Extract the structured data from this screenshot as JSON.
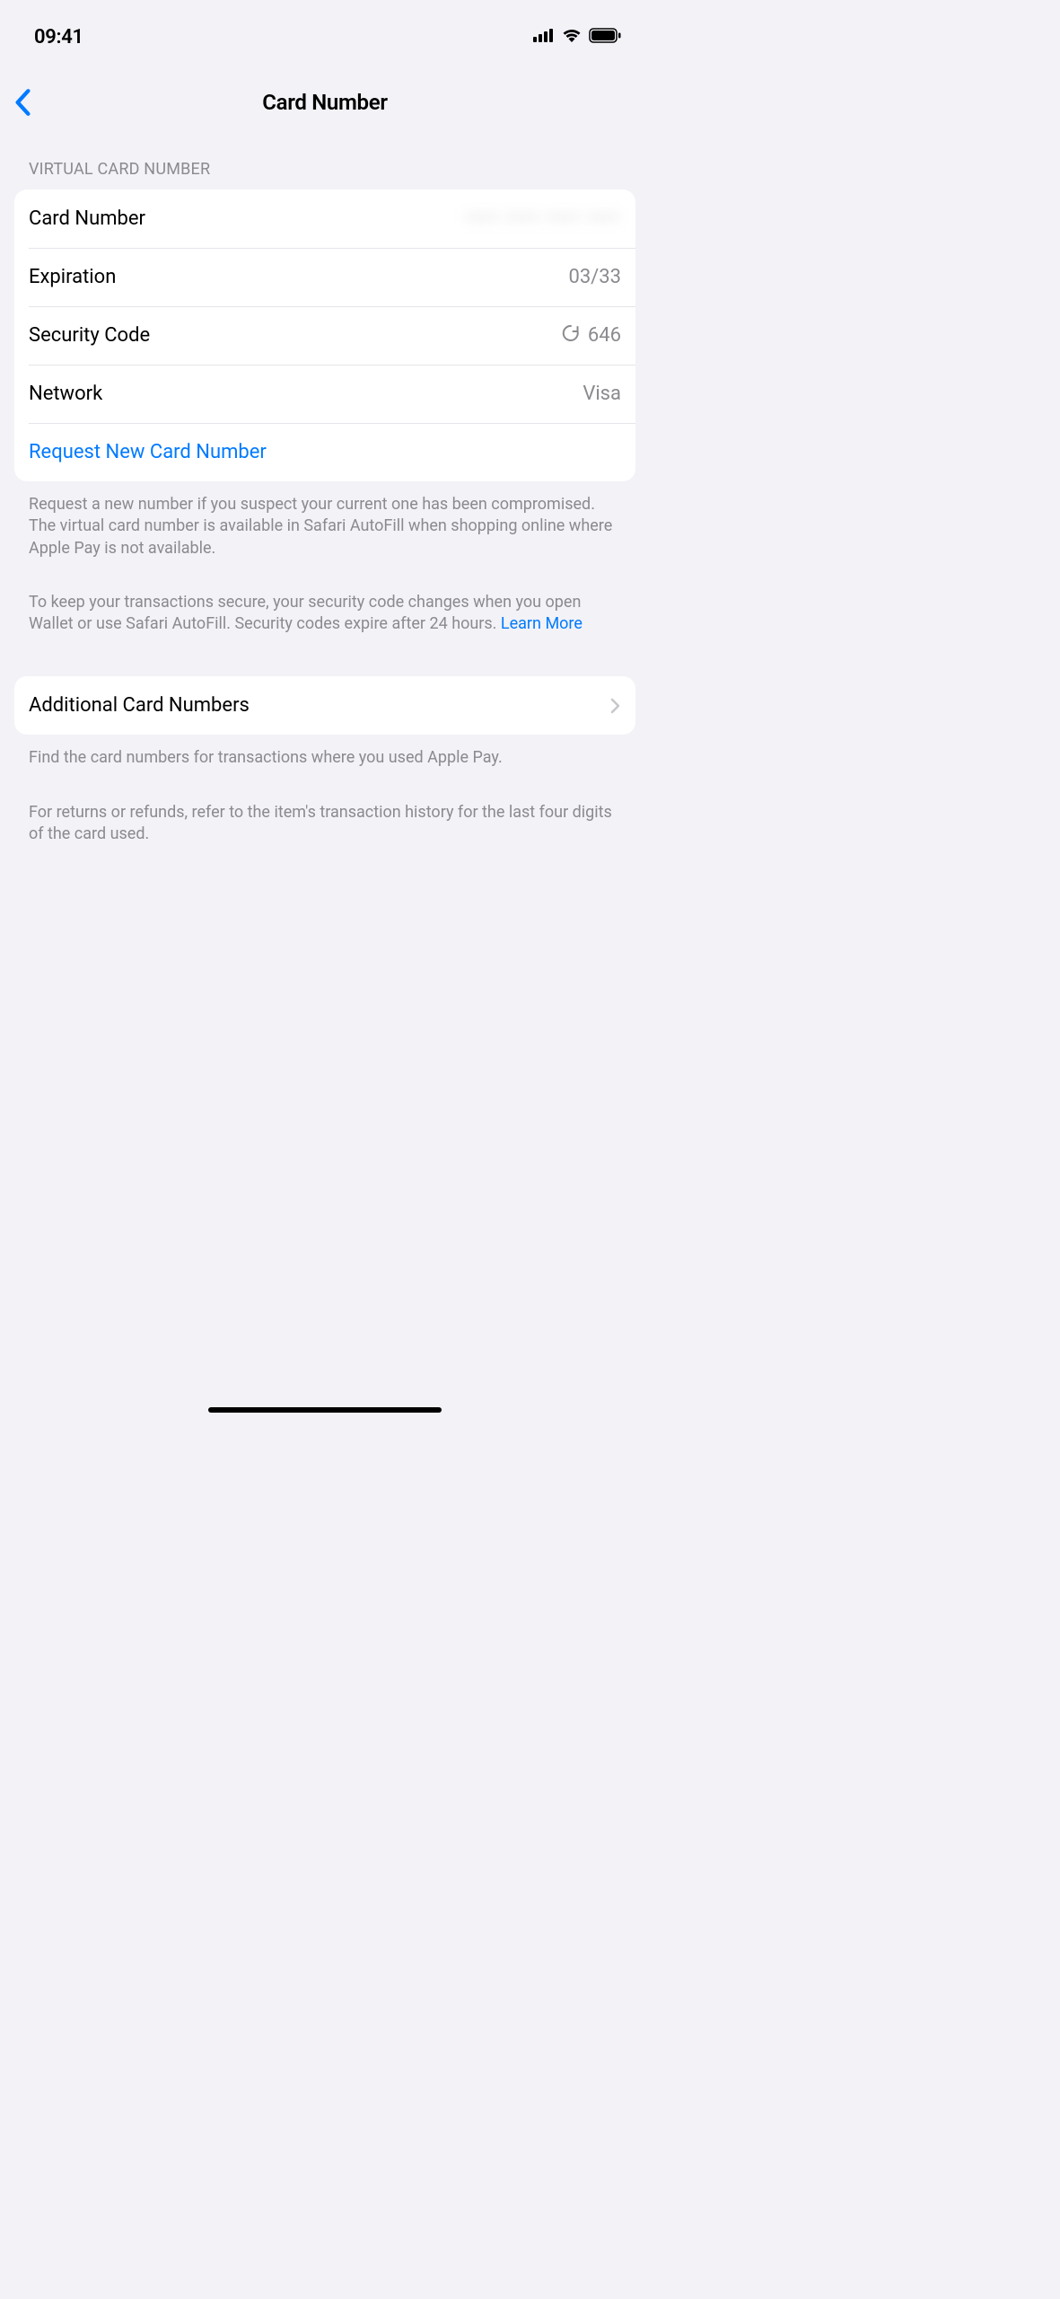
{
  "status": {
    "time": "09:41"
  },
  "nav": {
    "title": "Card Number"
  },
  "section1": {
    "header": "VIRTUAL CARD NUMBER",
    "rows": {
      "cardNumber": {
        "label": "Card Number",
        "value": "•••• •••• •••• ••••"
      },
      "expiration": {
        "label": "Expiration",
        "value": "03/33"
      },
      "securityCode": {
        "label": "Security Code",
        "value": "646"
      },
      "network": {
        "label": "Network",
        "value": "Visa"
      },
      "request": {
        "label": "Request New Card Number"
      }
    },
    "footer1": "Request a new number if you suspect your current one has been compromised. The virtual card number is available in Safari AutoFill when shopping online where Apple Pay is not available.",
    "footer2a": "To keep your transactions secure, your security code changes when you open Wallet or use Safari AutoFill. Security codes expire after 24 hours. ",
    "footer2link": "Learn More"
  },
  "section2": {
    "row": {
      "label": "Additional Card Numbers"
    },
    "footer1": "Find the card numbers for transactions where you used Apple Pay.",
    "footer2": "For returns or refunds, refer to the item's transaction history for the last four digits of the card used."
  }
}
